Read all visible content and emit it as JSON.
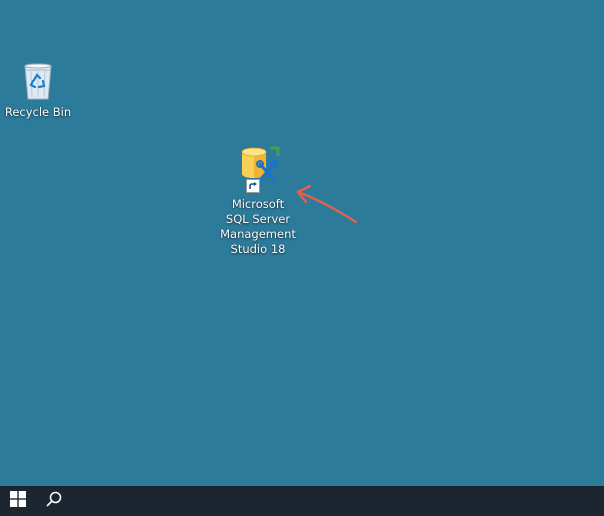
{
  "desktop": {
    "icons": [
      {
        "label": "Recycle Bin",
        "icon": "recycle-bin-icon"
      },
      {
        "label": "Microsoft\nSQL Server\nManagement\nStudio 18",
        "icon": "ssms-icon"
      }
    ]
  },
  "annotation": {
    "arrow_color": "#e8604c"
  },
  "taskbar": {
    "start_icon": "windows-logo-icon",
    "search_icon": "search-icon"
  },
  "colors": {
    "desktop_background": "#2c7b9b",
    "taskbar_background": "#1b2631"
  }
}
